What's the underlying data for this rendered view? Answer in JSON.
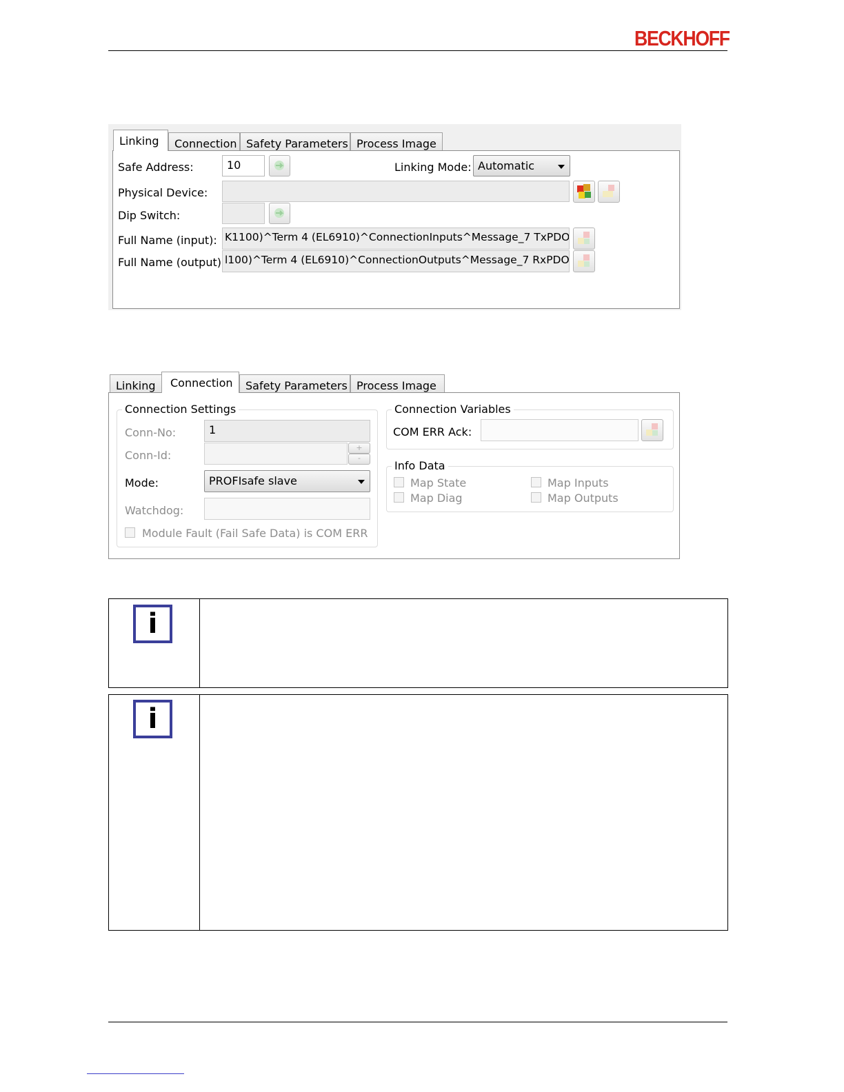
{
  "header": {
    "brand": "BECKHOFF"
  },
  "linking_dialog": {
    "tabs": [
      "Linking",
      "Connection",
      "Safety Parameters",
      "Process Image"
    ],
    "safe_address_label": "Safe Address:",
    "safe_address_value": "10",
    "linking_mode_label": "Linking Mode:",
    "linking_mode_value": "Automatic",
    "physical_device_label": "Physical Device:",
    "physical_device_value": "",
    "dip_switch_label": "Dip Switch:",
    "full_name_input_label": "Full Name (input):",
    "full_name_input_value": "K1100)^Term 4 (EL6910)^ConnectionInputs^Message_7 TxPDO",
    "full_name_output_label": "Full Name (output):",
    "full_name_output_value": "l100)^Term 4 (EL6910)^ConnectionOutputs^Message_7 RxPDO"
  },
  "connection_dialog": {
    "tabs": [
      "Linking",
      "Connection",
      "Safety Parameters",
      "Process Image"
    ],
    "settings_title": "Connection Settings",
    "conn_no_label": "Conn-No:",
    "conn_no_value": "1",
    "conn_id_label": "Conn-Id:",
    "conn_id_value": "",
    "mode_label": "Mode:",
    "mode_value": "PROFIsafe slave",
    "watchdog_label": "Watchdog:",
    "watchdog_value": "",
    "module_fault_label": "Module Fault (Fail Safe Data) is COM ERR",
    "variables_title": "Connection Variables",
    "com_err_ack_label": "COM ERR Ack:",
    "com_err_ack_value": "",
    "info_data_title": "Info Data",
    "map_state_label": "Map State",
    "map_diag_label": "Map Diag",
    "map_inputs_label": "Map Inputs",
    "map_outputs_label": "Map Outputs",
    "spin_plus": "+",
    "spin_minus": "-"
  },
  "notes": {
    "icon_glyph": "i"
  },
  "colors": {
    "brand_red": "#d7261e",
    "note_icon_blue": "#3b3f9a"
  }
}
